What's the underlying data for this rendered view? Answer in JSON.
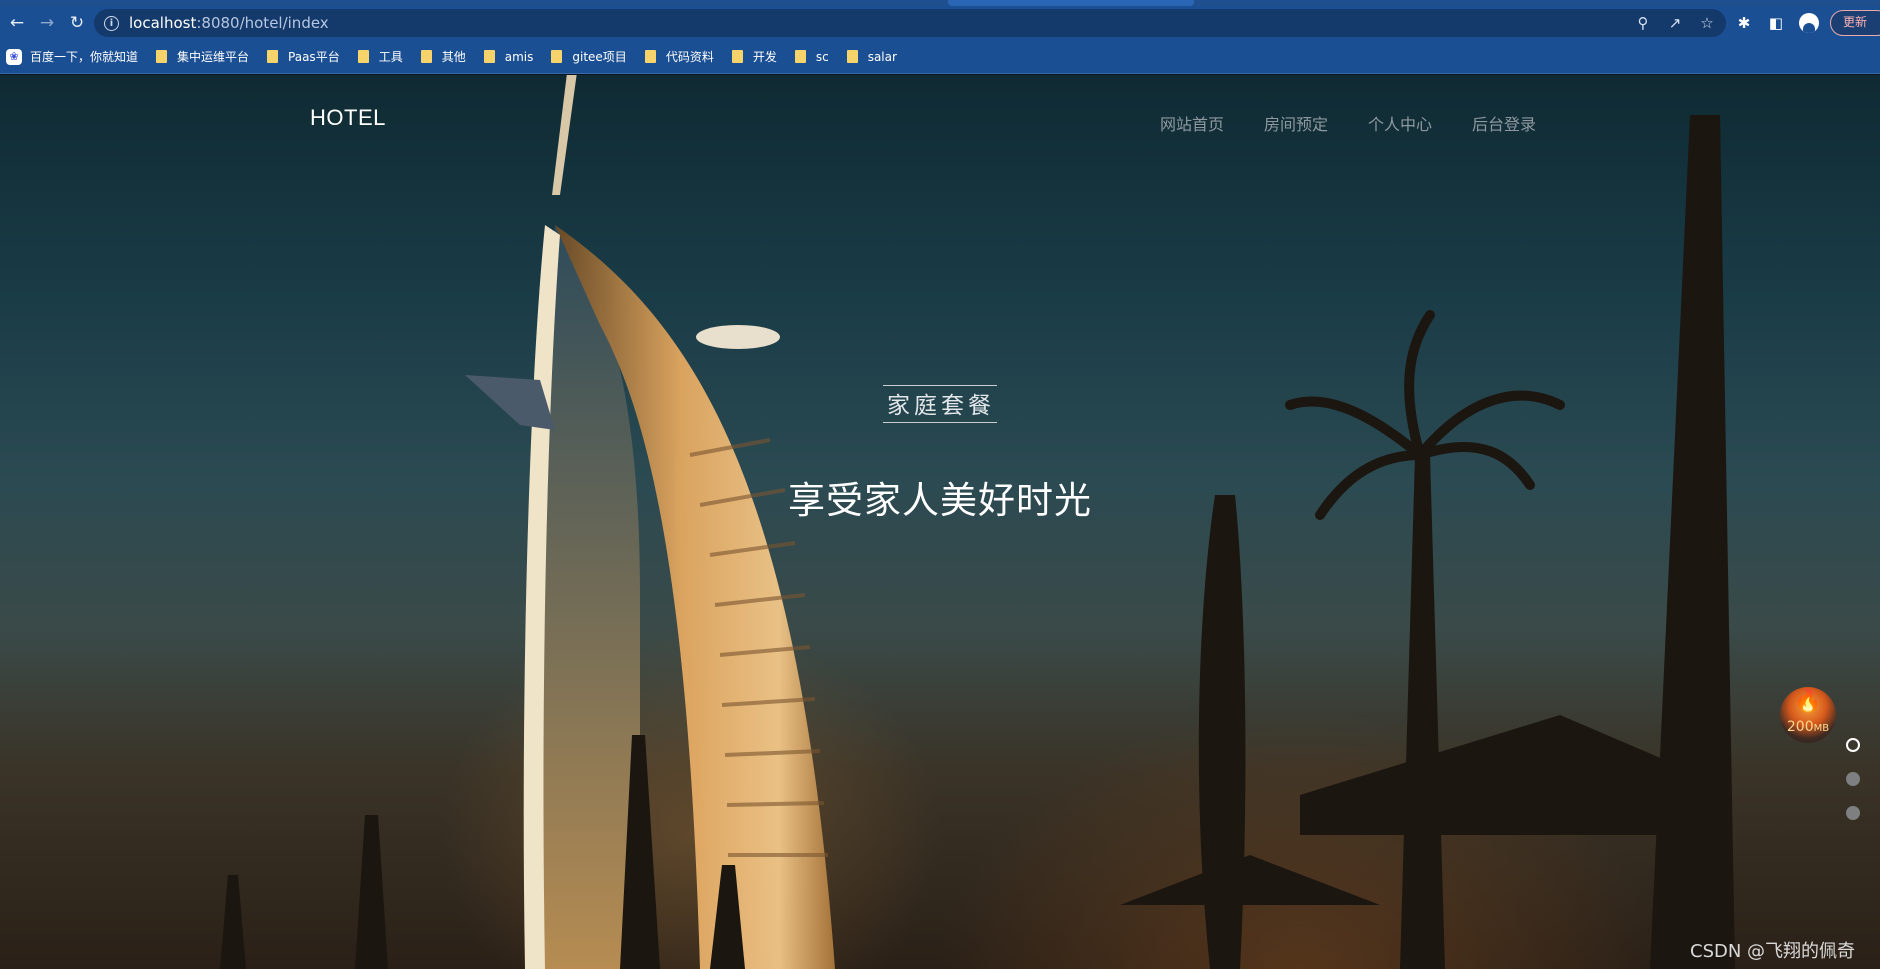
{
  "browser": {
    "url_host": "localhost",
    "url_path": ":8080/hotel/index",
    "update_label": "更新",
    "bookmarks": [
      {
        "label": "百度一下，你就知道",
        "icon": "baidu-icon"
      },
      {
        "label": "集中运维平台",
        "icon": "folder-icon"
      },
      {
        "label": "Paas平台",
        "icon": "folder-icon"
      },
      {
        "label": "工具",
        "icon": "folder-icon"
      },
      {
        "label": "其他",
        "icon": "folder-icon"
      },
      {
        "label": "amis",
        "icon": "folder-icon"
      },
      {
        "label": "gitee项目",
        "icon": "folder-icon"
      },
      {
        "label": "代码资料",
        "icon": "folder-icon"
      },
      {
        "label": "开发",
        "icon": "folder-icon"
      },
      {
        "label": "sc",
        "icon": "folder-icon"
      },
      {
        "label": "salar",
        "icon": "folder-icon"
      }
    ]
  },
  "site": {
    "logo": "HOTEL",
    "nav": [
      "网站首页",
      "房间预定",
      "个人中心",
      "后台登录"
    ]
  },
  "hero": {
    "subtitle": "家庭套餐",
    "title": "享受家人美好时光",
    "slide_count": 3,
    "active_slide": 0
  },
  "overlay": {
    "memory_value": "200",
    "memory_unit": "MB"
  },
  "watermark": "CSDN @飞翔的佩奇",
  "colors": {
    "chrome": "#1b4f93",
    "omnibox": "#14396b",
    "nav_text": "#8e98a0",
    "hero_text": "#ffffff"
  }
}
